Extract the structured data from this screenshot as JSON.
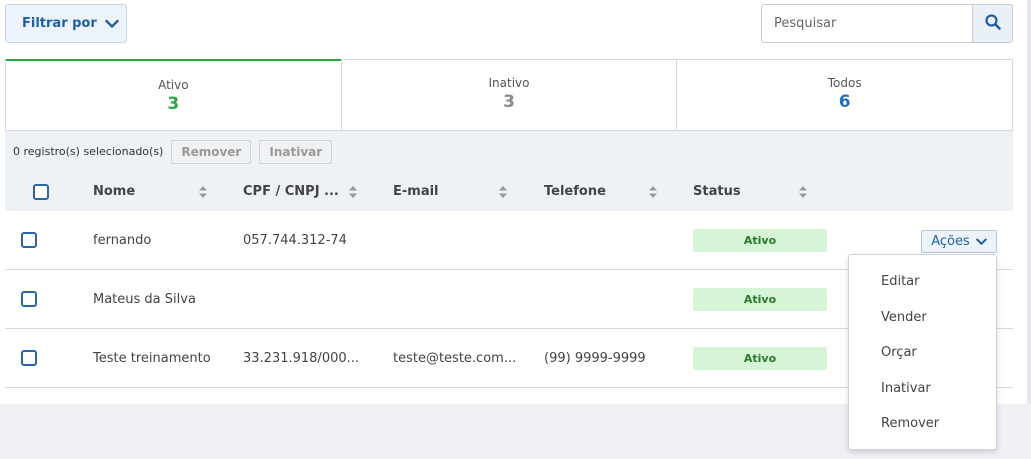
{
  "toolbar": {
    "filter_label": "Filtrar por",
    "search_placeholder": "Pesquisar"
  },
  "tabs": [
    {
      "label": "Ativo",
      "count": "3",
      "color": "#28a745"
    },
    {
      "label": "Inativo",
      "count": "3",
      "color": "#8a8a8a"
    },
    {
      "label": "Todos",
      "count": "6",
      "color": "#1f6fc5"
    }
  ],
  "bulk": {
    "selected_text": "0 registro(s) selecionado(s)",
    "remove_label": "Remover",
    "deactivate_label": "Inativar"
  },
  "table": {
    "columns": [
      "Nome",
      "CPF / CNPJ ...",
      "E-mail",
      "Telefone",
      "Status"
    ],
    "rows": [
      {
        "nome": "fernando",
        "cpf": "057.744.312-74",
        "email": "",
        "telefone": "",
        "status": "Ativo",
        "acoes": "Ações"
      },
      {
        "nome": "Mateus da Silva",
        "cpf": "",
        "email": "",
        "telefone": "",
        "status": "Ativo"
      },
      {
        "nome": "Teste treinamento",
        "cpf": "33.231.918/000...",
        "email": "teste@teste.com...",
        "telefone": "(99) 9999-9999",
        "status": "Ativo"
      }
    ]
  },
  "actions_menu": {
    "items": [
      "Editar",
      "Vender",
      "Orçar",
      "Inativar",
      "Remover"
    ]
  },
  "colors": {
    "accent": "#1f5fa5",
    "status_badge_bg": "#d6f5d6",
    "status_badge_text": "#2a7a2a"
  }
}
